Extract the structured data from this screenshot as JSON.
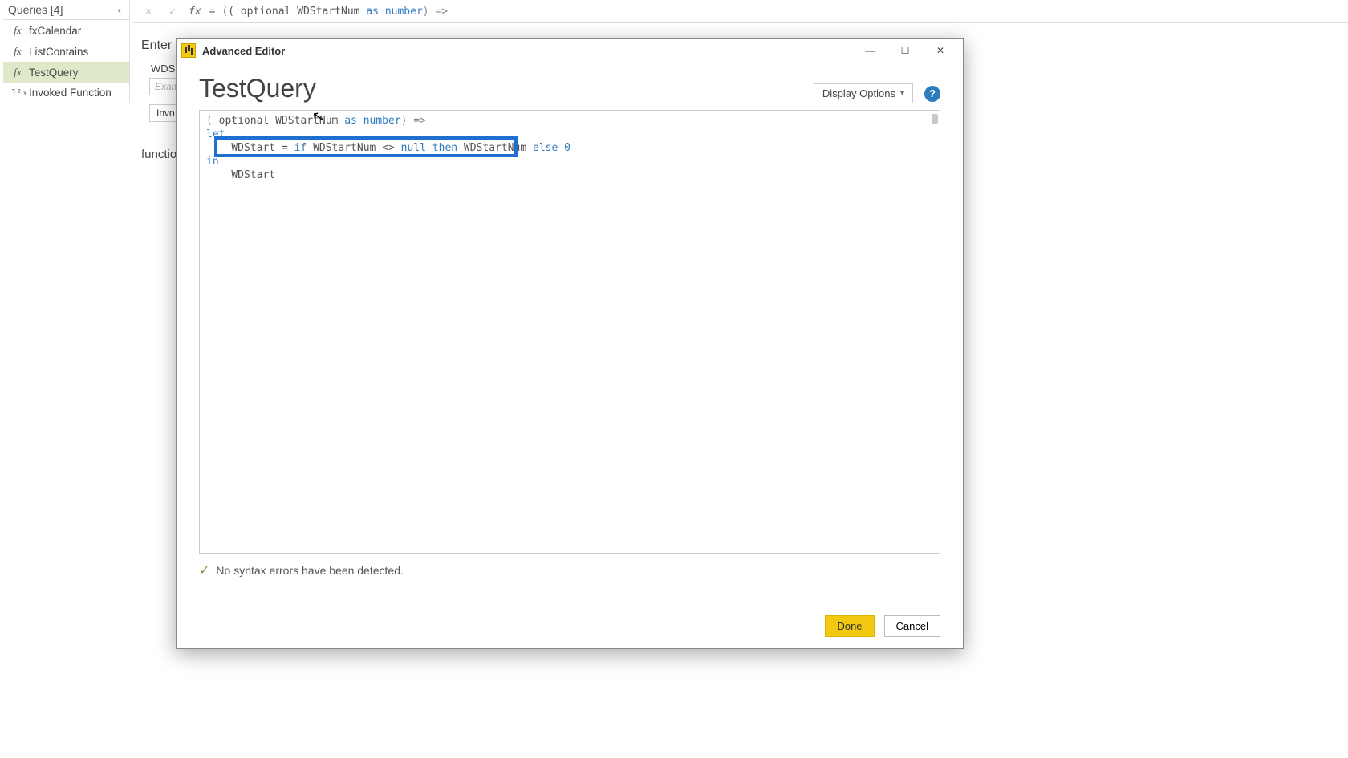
{
  "queries": {
    "header": "Queries [4]",
    "items": [
      {
        "icon": "fx",
        "label": "fxCalendar"
      },
      {
        "icon": "fx",
        "label": "ListContains"
      },
      {
        "icon": "fx",
        "label": "TestQuery",
        "selected": true
      },
      {
        "icon": "1²₃",
        "label": "Invoked Function"
      }
    ]
  },
  "formula_bar": {
    "prefix": "=",
    "code_plain": "( optional WDStartNum ",
    "kw_as": "as",
    "kw_type": "number",
    "code_tail": ") =>"
  },
  "background": {
    "enter_label": "Enter",
    "wd_label": "WDSta",
    "exam_placeholder": "Exam",
    "invoke_btn": "Invo",
    "function_label": "function"
  },
  "dialog": {
    "window_title": "Advanced Editor",
    "title": "TestQuery",
    "display_options": "Display Options",
    "code": {
      "l1_a": "(",
      "l1_b": " optional WDStartNum ",
      "l1_as": "as",
      "l1_sp": " ",
      "l1_num": "number",
      "l1_c": ") =>",
      "l2": "let",
      "l3_a": "WDStart = ",
      "l3_if": "if",
      "l3_b": " WDStartNum <> ",
      "l3_null": "null",
      "l3_sp1": " ",
      "l3_then": "then",
      "l3_c": " WDStartNum ",
      "l3_else": "else",
      "l3_sp2": " ",
      "l3_zero": "0",
      "l4": "in",
      "l5": "WDStart"
    },
    "status": "No syntax errors have been detected.",
    "done": "Done",
    "cancel": "Cancel"
  }
}
